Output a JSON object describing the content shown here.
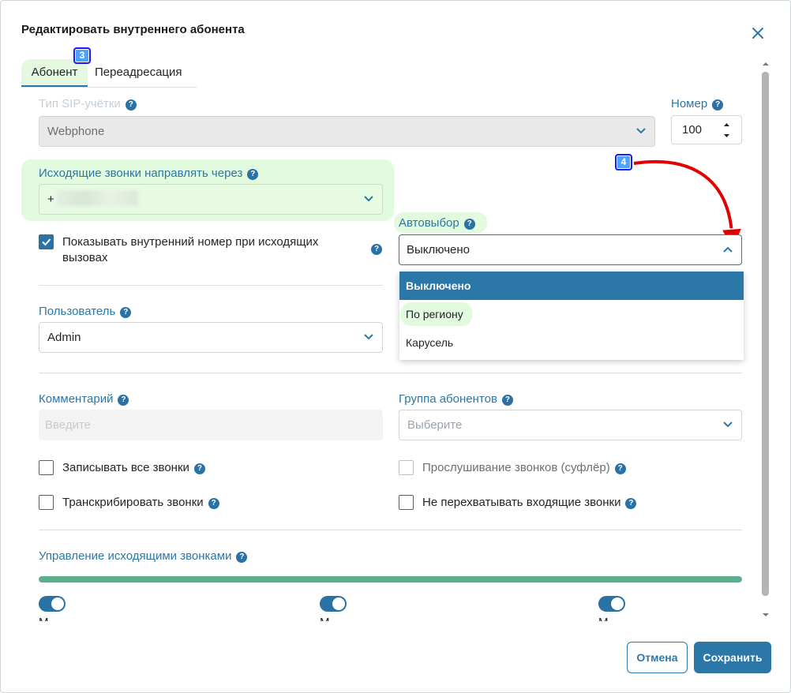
{
  "dialog": {
    "title": "Редактировать внутреннего абонента",
    "close_icon": "close-icon"
  },
  "tabs": [
    {
      "label": "Абонент",
      "active": true
    },
    {
      "label": "Переадресация",
      "active": false
    }
  ],
  "annotations": {
    "badge_3": "3",
    "badge_4": "4"
  },
  "sip_type": {
    "label": "Тип SIP-учётки",
    "value": "Webphone"
  },
  "number": {
    "label": "Номер",
    "value": "100"
  },
  "outgoing": {
    "label": "Исходящие звонки направлять через",
    "value_prefix": "+"
  },
  "show_internal": {
    "label": "Показывать внутренний номер при исходящих вызовах",
    "checked": true
  },
  "autoselect": {
    "label": "Автовыбор",
    "value": "Выключено",
    "options": [
      "Выключено",
      "По региону",
      "Карусель"
    ],
    "selected_index": 0
  },
  "user": {
    "label": "Пользователь",
    "value": "Admin"
  },
  "comment": {
    "label": "Комментарий",
    "placeholder": "Введите"
  },
  "group": {
    "label": "Группа абонентов",
    "placeholder": "Выберите"
  },
  "checks": {
    "record_all": "Записывать все звонки",
    "transcribe": "Транскрибировать звонки",
    "listen": "Прослушивание звонков (суфлёр)",
    "no_intercept": "Не перехватывать входящие звонки"
  },
  "outgoing_mgmt": {
    "label": "Управление исходящими звонками",
    "progress": 1.0,
    "toggle_labels": [
      "М",
      "М",
      "М"
    ]
  },
  "buttons": {
    "cancel": "Отмена",
    "save": "Сохранить"
  },
  "colors": {
    "accent": "#2b78a8",
    "highlight": "#e2fadd",
    "annotation_arrow": "#e00000",
    "progress": "#5aaf8c"
  }
}
